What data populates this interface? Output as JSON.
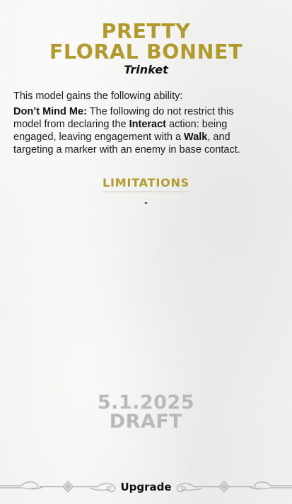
{
  "card": {
    "title_line_1": "PRETTY",
    "title_line_2": "FLORAL BONNET",
    "subtitle": "Trinket",
    "intro": "This model gains the following ability:",
    "ability": {
      "name": "Don’t Mind Me:",
      "text_1": " The following do not restrict this model from declaring the ",
      "keyword_1": "Interact",
      "text_2": " action: being engaged, leaving engagement with a ",
      "keyword_2": "Walk",
      "text_3": ", and targeting a marker with an enemy in base contact."
    },
    "limitations": {
      "heading": "LIMITATIONS",
      "value": "-"
    },
    "watermark": {
      "line_1": "5.1.2025",
      "line_2": "DRAFT"
    },
    "footer_label": "Upgrade"
  },
  "colors": {
    "accent_gold": "#b29a2c",
    "watermark_gray": "#b9b9b9",
    "background": "#f2f2f1",
    "ornament": "#b5b5b5"
  },
  "icons": {
    "footer_ornament": "scroll-filigree-icon"
  }
}
